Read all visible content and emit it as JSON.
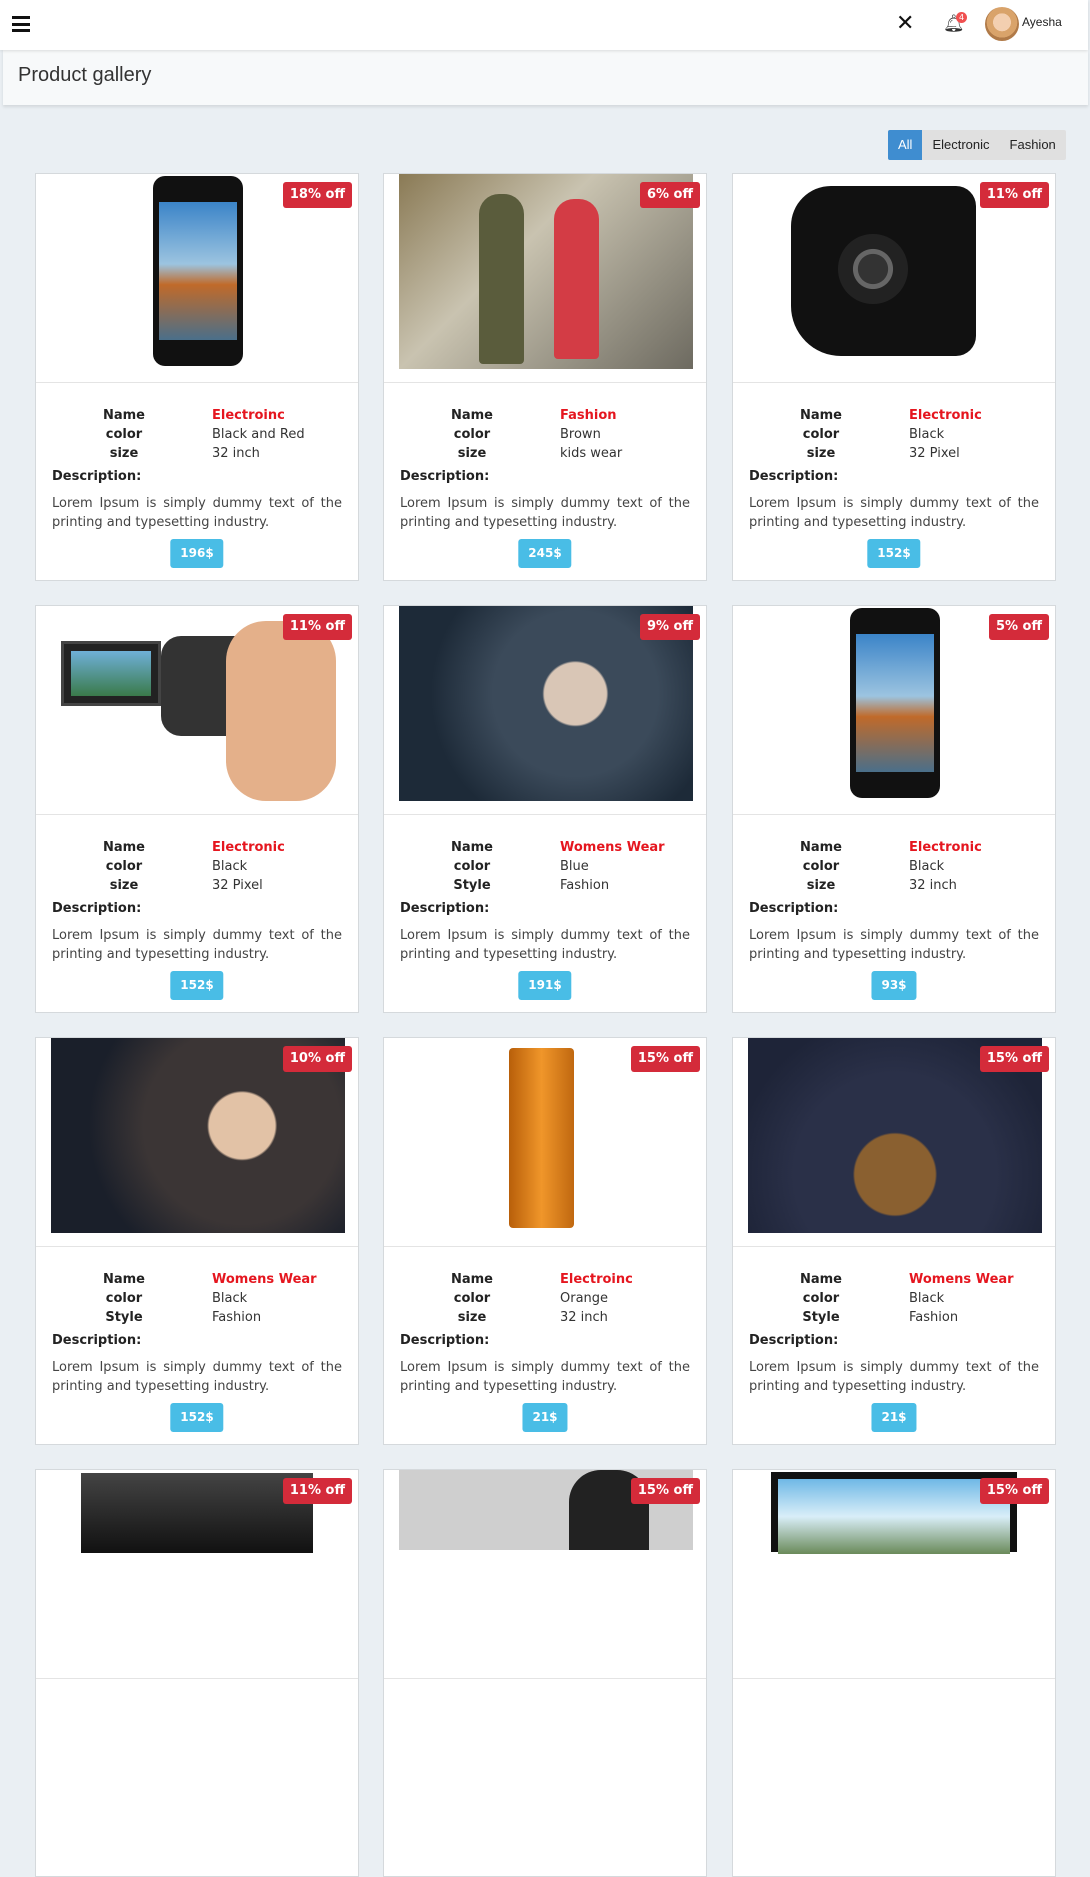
{
  "topbar": {
    "user_name": "Ayesha",
    "notification_count": "4"
  },
  "page_title": "Product gallery",
  "filters": [
    "All",
    "Electronic",
    "Fashion"
  ],
  "description_label": "Description:",
  "cards": [
    {
      "discount": "18% off",
      "image": "phone",
      "labels": [
        "Name",
        "color",
        "size"
      ],
      "values": [
        "Electroinc",
        "Black and Red",
        "32 inch"
      ],
      "description": "Lorem Ipsum is simply dummy text of the printing and typesetting industry.",
      "price": "196$"
    },
    {
      "discount": "6% off",
      "image": "kids",
      "labels": [
        "Name",
        "color",
        "size"
      ],
      "values": [
        "Fashion",
        "Brown",
        "kids wear"
      ],
      "description": "Lorem Ipsum is simply dummy text of the printing and typesetting industry.",
      "price": "245$"
    },
    {
      "discount": "11% off",
      "image": "camera",
      "labels": [
        "Name",
        "color",
        "size"
      ],
      "values": [
        "Electronic",
        "Black",
        "32 Pixel"
      ],
      "description": "Lorem Ipsum is simply dummy text of the printing and typesetting industry.",
      "price": "152$"
    },
    {
      "discount": "11% off",
      "image": "camcorder",
      "labels": [
        "Name",
        "color",
        "size"
      ],
      "values": [
        "Electronic",
        "Black",
        "32 Pixel"
      ],
      "description": "Lorem Ipsum is simply dummy text of the printing and typesetting industry.",
      "price": "152$"
    },
    {
      "discount": "9% off",
      "image": "woman-winter",
      "labels": [
        "Name",
        "color",
        "Style"
      ],
      "values": [
        "Womens Wear",
        "Blue",
        "Fashion"
      ],
      "description": "Lorem Ipsum is simply dummy text of the printing and typesetting industry.",
      "price": "191$"
    },
    {
      "discount": "5% off",
      "image": "phone",
      "labels": [
        "Name",
        "color",
        "size"
      ],
      "values": [
        "Electronic",
        "Black",
        "32 inch"
      ],
      "description": "Lorem Ipsum is simply dummy text of the printing and typesetting industry.",
      "price": "93$"
    },
    {
      "discount": "10% off",
      "image": "woman-fur",
      "labels": [
        "Name",
        "color",
        "Style"
      ],
      "values": [
        "Womens Wear",
        "Black",
        "Fashion"
      ],
      "description": "Lorem Ipsum is simply dummy text of the printing and typesetting industry.",
      "price": "152$"
    },
    {
      "discount": "15% off",
      "image": "fridge",
      "labels": [
        "Name",
        "color",
        "size"
      ],
      "values": [
        "Electroinc",
        "Orange",
        "32 inch"
      ],
      "description": "Lorem Ipsum is simply dummy text of the printing and typesetting industry.",
      "price": "21$"
    },
    {
      "discount": "15% off",
      "image": "woman-coat",
      "labels": [
        "Name",
        "color",
        "Style"
      ],
      "values": [
        "Womens Wear",
        "Black",
        "Fashion"
      ],
      "description": "Lorem Ipsum is simply dummy text of the printing and typesetting industry.",
      "price": "21$"
    },
    {
      "discount": "11% off",
      "image": "tv"
    },
    {
      "discount": "15% off",
      "image": "man"
    },
    {
      "discount": "15% off",
      "image": "monitor"
    }
  ]
}
